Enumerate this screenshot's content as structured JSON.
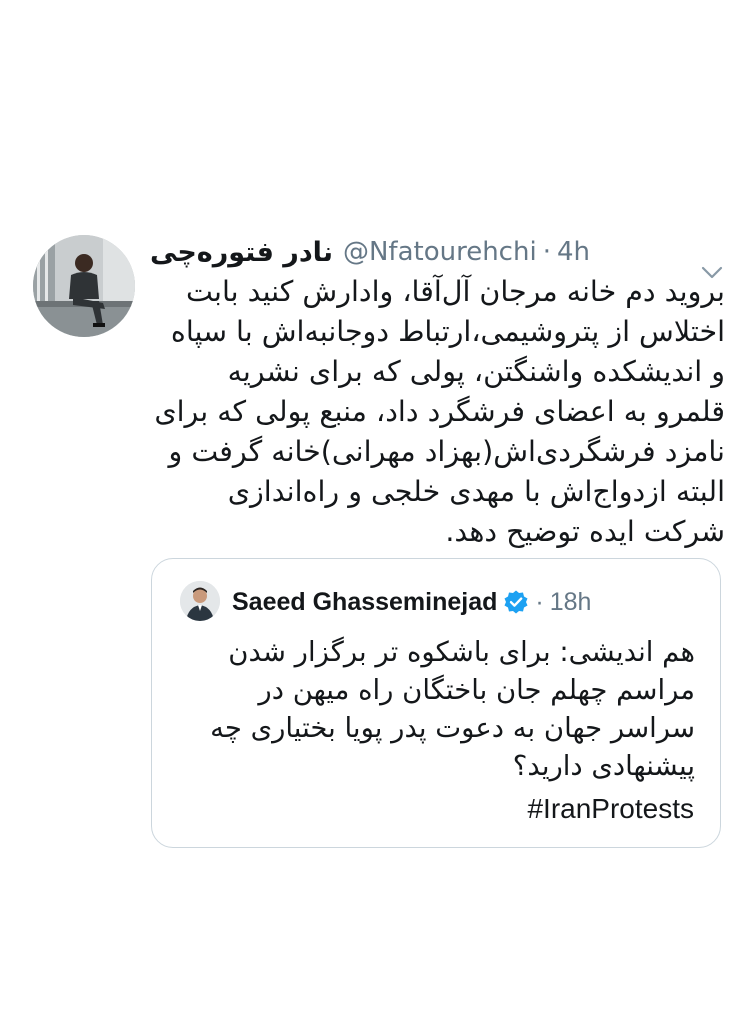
{
  "tweet": {
    "author_name": "نادر فتوره‌چی",
    "handle": "@Nfatourehchi",
    "separator": "·",
    "time": "4h",
    "text": "بروید دم خانه مرجان آل‌آقا، وادارش کنید بابت اختلاس از پتروشیمی،ارتباط دوجانبه‌اش با سپاه و اندیشکده واشنگتن، پولی که برای نشریه قلمرو به اعضای فرشگرد داد، منبع پولی که برای نامزد فرشگردی‌اش(بهزاد مهرانی)خانه گرفت و البته ازدواج‌اش با مهدی خلجی و راه‌اندازی شرکت ایده توضیح دهد.",
    "avatar_icon": "profile-photo",
    "menu_icon": "chevron-down"
  },
  "quoted_tweet": {
    "author_name": "Saeed Ghasseminejad",
    "verified": true,
    "verified_icon": "verified-badge",
    "separator": "·",
    "time": "18h",
    "text": "هم اندیشی: برای باشکوه تر برگزار شدن مراسم چهلم جان باختگان راه میهن در سراسر جهان به دعوت پدر پویا بختیاری چه پیشنهادی دارید؟",
    "hashtag": "#IranProtests",
    "avatar_icon": "profile-photo"
  },
  "colors": {
    "text": "#14171a",
    "secondary": "#657786",
    "border": "#ccd6dd",
    "verified": "#1da1f2"
  }
}
